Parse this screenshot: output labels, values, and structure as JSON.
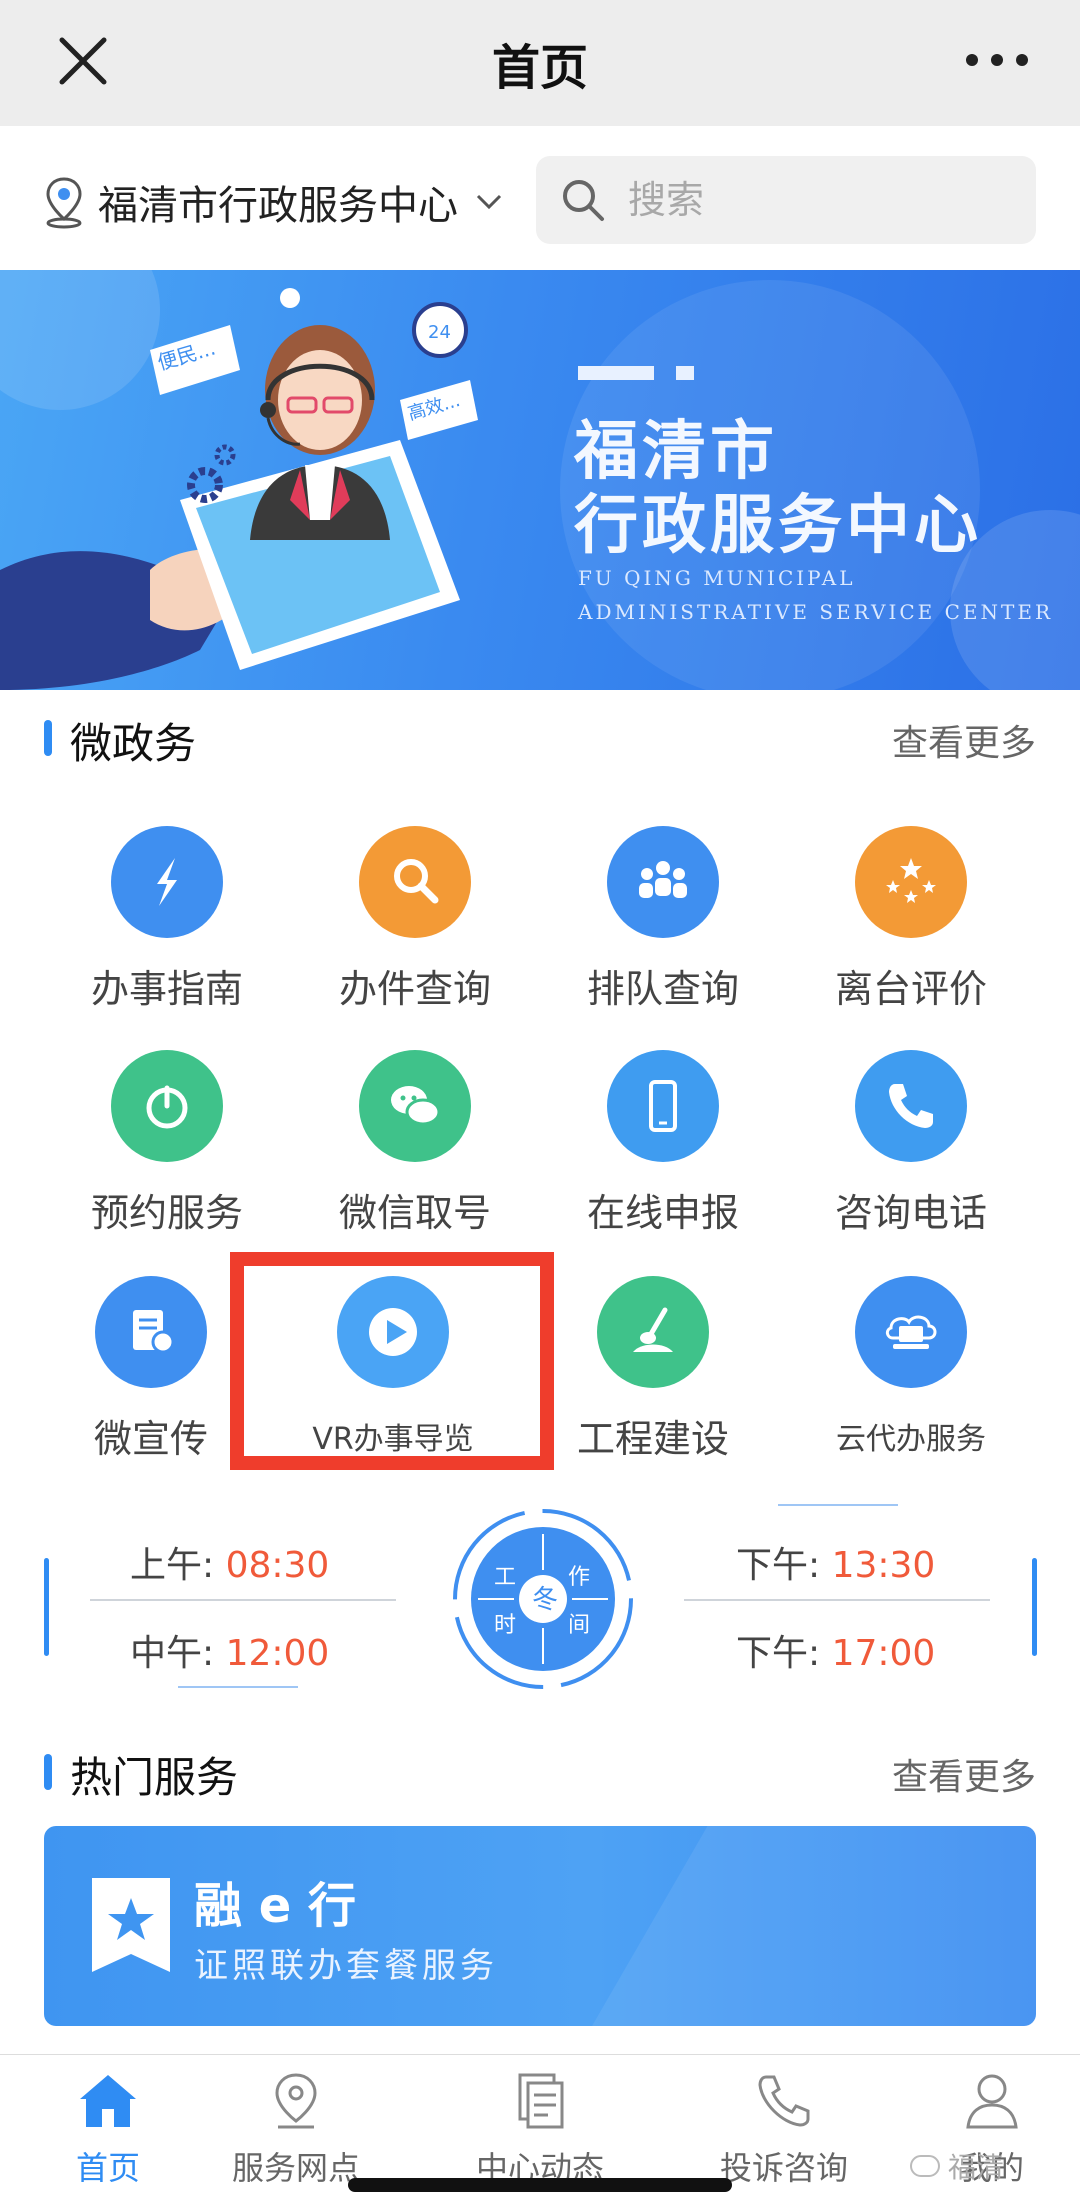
{
  "header": {
    "title": "首页"
  },
  "location": {
    "name": "福清市行政服务中心"
  },
  "search": {
    "placeholder": "搜索"
  },
  "banner": {
    "title_line1": "福清市",
    "title_line2": "行政服务中心",
    "en_line1": "FU QING MUNICIPAL",
    "en_line2": "ADMINISTRATIVE SERVICE CENTER",
    "bubble1": "便民...",
    "bubble2": "高效...",
    "clock_text": "24"
  },
  "micro_gov": {
    "title": "微政务",
    "more": "查看更多",
    "items": [
      {
        "label": "办事指南",
        "icon": "compass-icon",
        "color": "#3f8ff0"
      },
      {
        "label": "办件查询",
        "icon": "search-icon",
        "color": "#f39a36"
      },
      {
        "label": "排队查询",
        "icon": "people-icon",
        "color": "#3f8ff0"
      },
      {
        "label": "离台评价",
        "icon": "stars-icon",
        "color": "#f39a36"
      },
      {
        "label": "预约服务",
        "icon": "power-icon",
        "color": "#3fc28a"
      },
      {
        "label": "微信取号",
        "icon": "wechat-icon",
        "color": "#3fc28a"
      },
      {
        "label": "在线申报",
        "icon": "phone-icon",
        "color": "#3f9cf0"
      },
      {
        "label": "咨询电话",
        "icon": "call-icon",
        "color": "#3f9cf0"
      },
      {
        "label": "微宣传",
        "icon": "document-icon",
        "color": "#3f8ff0"
      },
      {
        "label": "VR办事导览",
        "icon": "play-icon",
        "color": "#4aa4f5"
      },
      {
        "label": "工程建设",
        "icon": "shovel-icon",
        "color": "#3fc28a"
      },
      {
        "label": "云代办服务",
        "icon": "laptop-cloud-icon",
        "color": "#3f8ff0"
      }
    ]
  },
  "work_time": {
    "clock_chars": [
      "工",
      "作",
      "时",
      "间"
    ],
    "season": "冬",
    "am_label": "上午:",
    "am_value": "08:30",
    "noon_label": "中午:",
    "noon_value": "12:00",
    "pm1_label": "下午:",
    "pm1_value": "13:30",
    "pm2_label": "下午:",
    "pm2_value": "17:00"
  },
  "hot_services": {
    "title": "热门服务",
    "more": "查看更多",
    "card": {
      "name": "融 e 行",
      "subtitle": "证照联办套餐服务"
    }
  },
  "tabbar": {
    "items": [
      {
        "label": "首页",
        "icon": "home-icon"
      },
      {
        "label": "服务网点",
        "icon": "location-pin-icon"
      },
      {
        "label": "中心动态",
        "icon": "news-icon"
      },
      {
        "label": "投诉咨询",
        "icon": "phone-icon"
      },
      {
        "label": "我的",
        "icon": "user-icon"
      }
    ]
  },
  "watermark": "福清",
  "colors": {
    "accent": "#2f8cf3",
    "time": "#f05a3a",
    "highlight": "#ef3d2c"
  }
}
